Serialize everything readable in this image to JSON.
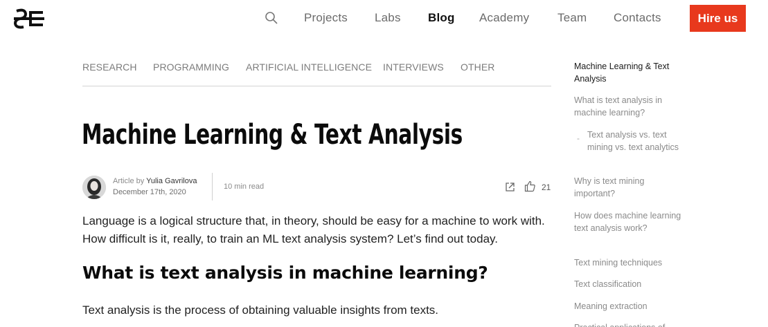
{
  "header": {
    "logo_icon": "logo-mark",
    "search_icon": "search-icon",
    "nav": [
      {
        "label": "Projects",
        "active": false
      },
      {
        "label": "Labs",
        "active": false
      },
      {
        "label": "Blog",
        "active": true
      },
      {
        "label": "Academy",
        "active": false
      },
      {
        "label": "Team",
        "active": false
      },
      {
        "label": "Contacts",
        "active": false
      }
    ],
    "cta_label": "Hire us"
  },
  "categories": [
    "RESEARCH",
    "PROGRAMMING",
    "ARTIFICIAL INTELLIGENCE",
    "INTERVIEWS",
    "OTHER"
  ],
  "article": {
    "title": "Machine Learning & Text Analysis",
    "meta": {
      "by_prefix": "Article by",
      "author": "Yulia Gavrilova",
      "date": "December 17th, 2020",
      "read_time": "10 min read",
      "likes": "21"
    },
    "intro": "Language is a logical structure that, in theory, should be easy for a machine to work with. How difficult is it, really, to train an ML text analysis system? Let’s find out today.",
    "section_heading": "What is text analysis in machine learning?",
    "paragraph": "Text analysis is the process of obtaining valuable insights from texts."
  },
  "toc": [
    {
      "label": "Machine Learning & Text Analysis",
      "active": true,
      "sub": false
    },
    {
      "label": "What is text analysis in machine learning?",
      "active": false,
      "sub": false
    },
    {
      "label": "Text analysis vs. text mining vs. text analytics",
      "active": false,
      "sub": true
    },
    {
      "label": "Why is text mining important?",
      "active": false,
      "sub": false
    },
    {
      "label": "How does machine learning text analysis work?",
      "active": false,
      "sub": false
    },
    {
      "label": "Text mining techniques",
      "active": false,
      "sub": false
    },
    {
      "label": "Text classification",
      "active": false,
      "sub": false
    },
    {
      "label": "Meaning extraction",
      "active": false,
      "sub": false
    },
    {
      "label": "Practical applications of",
      "active": false,
      "sub": false
    }
  ],
  "colors": {
    "accent": "#e8391d",
    "text_muted": "#8a8a8a",
    "text_dark": "#111111"
  }
}
